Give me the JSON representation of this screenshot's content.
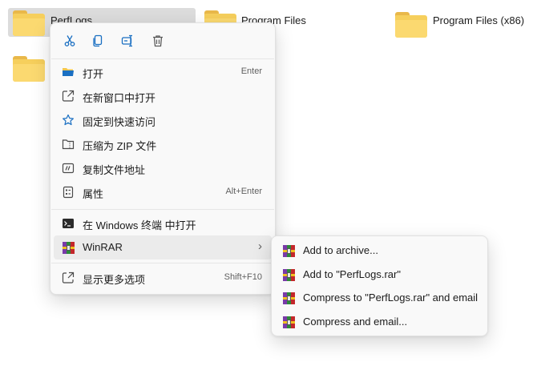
{
  "desktop": {
    "folders": [
      {
        "label": "PerfLogs",
        "selected": true
      },
      {
        "label": "Program Files"
      },
      {
        "label": "Program Files (x86)"
      },
      {
        "label": ""
      }
    ]
  },
  "context_menu": {
    "toolbar": [
      {
        "icon": "cut-icon",
        "action": "cut"
      },
      {
        "icon": "copy-icon",
        "action": "copy"
      },
      {
        "icon": "rename-icon",
        "action": "rename"
      },
      {
        "icon": "delete-icon",
        "action": "delete"
      }
    ],
    "items": [
      {
        "label": "打开",
        "icon": "folder-open-icon",
        "shortcut": "Enter"
      },
      {
        "label": "在新窗口中打开",
        "icon": "new-window-icon",
        "shortcut": ""
      },
      {
        "label": "固定到快速访问",
        "icon": "star-icon",
        "shortcut": ""
      },
      {
        "label": "压缩为 ZIP 文件",
        "icon": "zip-folder-icon",
        "shortcut": ""
      },
      {
        "label": "复制文件地址",
        "icon": "copy-path-icon",
        "shortcut": ""
      },
      {
        "label": "属性",
        "icon": "properties-icon",
        "shortcut": "Alt+Enter"
      },
      {
        "label": "在 Windows 终端 中打开",
        "icon": "terminal-icon",
        "shortcut": ""
      },
      {
        "label": "WinRAR",
        "icon": "winrar-icon",
        "shortcut": "",
        "has_submenu": true
      },
      {
        "label": "显示更多选项",
        "icon": "more-options-icon",
        "shortcut": "Shift+F10"
      }
    ]
  },
  "winrar_submenu": {
    "items": [
      {
        "label": "Add to archive...",
        "icon": "winrar-icon"
      },
      {
        "label": "Add to \"PerfLogs.rar\"",
        "icon": "winrar-icon"
      },
      {
        "label": "Compress to \"PerfLogs.rar\" and email",
        "icon": "winrar-icon"
      },
      {
        "label": "Compress and email...",
        "icon": "winrar-icon"
      }
    ]
  },
  "colors": {
    "menu_bg": "#f9f9f9",
    "hover_bg": "#ebebeb",
    "selection_bg": "#dcdcdc",
    "folder_yellow": "#f6cf5c",
    "icon_blue": "#1a6fc2"
  }
}
